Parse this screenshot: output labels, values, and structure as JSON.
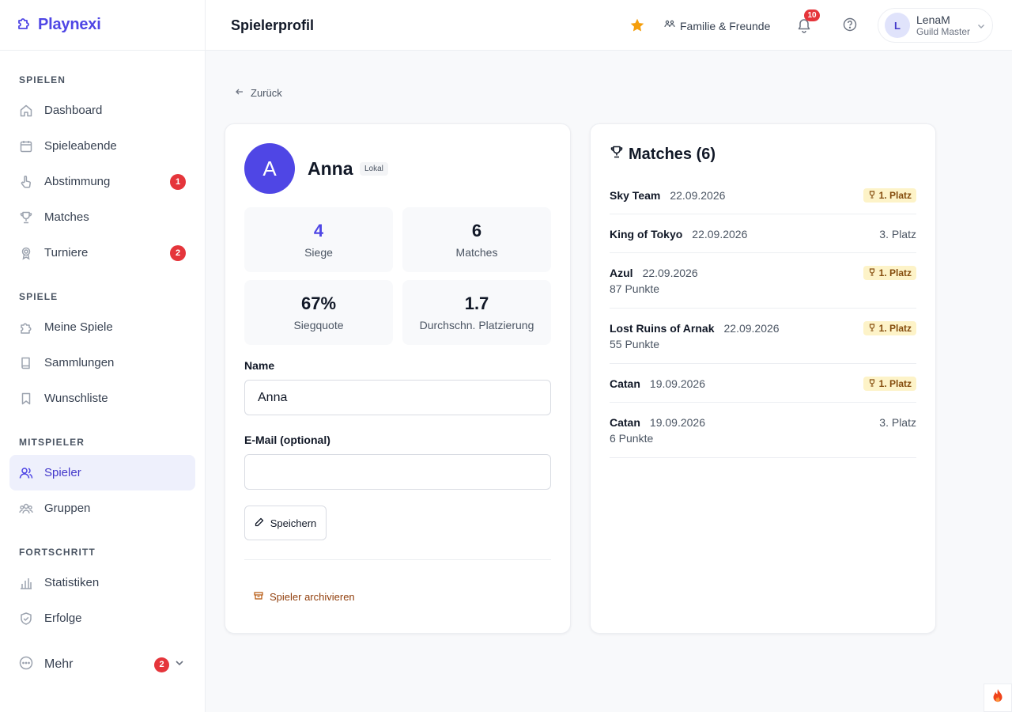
{
  "brand": {
    "name": "Playnexi"
  },
  "header": {
    "title": "Spielerprofil",
    "family_label": "Familie & Freunde",
    "notifications_count": "10",
    "user": {
      "initial": "L",
      "name": "LenaM",
      "role": "Guild Master"
    }
  },
  "sidebar": {
    "sections": [
      {
        "title": "SPIELEN",
        "items": [
          {
            "label": "Dashboard",
            "icon": "home-icon"
          },
          {
            "label": "Spieleabende",
            "icon": "calendar-icon"
          },
          {
            "label": "Abstimmung",
            "icon": "hand-pointer-icon",
            "badge": "1"
          },
          {
            "label": "Matches",
            "icon": "trophy-icon"
          },
          {
            "label": "Turniere",
            "icon": "award-icon",
            "badge": "2"
          }
        ]
      },
      {
        "title": "SPIELE",
        "items": [
          {
            "label": "Meine Spiele",
            "icon": "puzzle-icon"
          },
          {
            "label": "Sammlungen",
            "icon": "book-icon"
          },
          {
            "label": "Wunschliste",
            "icon": "bookmark-icon"
          }
        ]
      },
      {
        "title": "MITSPIELER",
        "items": [
          {
            "label": "Spieler",
            "icon": "users-icon",
            "active": true
          },
          {
            "label": "Gruppen",
            "icon": "group-icon"
          }
        ]
      },
      {
        "title": "FORTSCHRITT",
        "items": [
          {
            "label": "Statistiken",
            "icon": "bar-chart-icon"
          },
          {
            "label": "Erfolge",
            "icon": "shield-check-icon"
          }
        ]
      }
    ],
    "more": {
      "label": "Mehr",
      "badge": "2"
    }
  },
  "main": {
    "back_label": "Zurück",
    "profile": {
      "initial": "A",
      "name": "Anna",
      "badge": "Lokal",
      "stats": {
        "wins": {
          "value": "4",
          "label": "Siege"
        },
        "matches": {
          "value": "6",
          "label": "Matches"
        },
        "win_rate": {
          "value": "67%",
          "label": "Siegquote"
        },
        "avg_place": {
          "value": "1.7",
          "label": "Durchschn. Platzierung"
        }
      },
      "name_label": "Name",
      "name_value": "Anna",
      "email_label": "E-Mail (optional)",
      "email_value": "",
      "save_label": "Speichern",
      "archive_label": "Spieler archivieren"
    },
    "matches": {
      "title": "Matches (6)",
      "rows": [
        {
          "game": "Sky Team",
          "date": "22.09.2026",
          "place": "1. Platz",
          "winner": true,
          "points": ""
        },
        {
          "game": "King of Tokyo",
          "date": "22.09.2026",
          "place": "3. Platz",
          "winner": false,
          "points": ""
        },
        {
          "game": "Azul",
          "date": "22.09.2026",
          "place": "1. Platz",
          "winner": true,
          "points": "87 Punkte"
        },
        {
          "game": "Lost Ruins of Arnak",
          "date": "22.09.2026",
          "place": "1. Platz",
          "winner": true,
          "points": "55 Punkte"
        },
        {
          "game": "Catan",
          "date": "19.09.2026",
          "place": "1. Platz",
          "winner": true,
          "points": ""
        },
        {
          "game": "Catan",
          "date": "19.09.2026",
          "place": "3. Platz",
          "winner": false,
          "points": "6 Punkte"
        }
      ]
    }
  },
  "colors": {
    "accent": "#4f46e5",
    "badge_red": "#e5353b",
    "gold_bg": "#fdf3c8",
    "gold_text": "#854d0e",
    "star": "#f59e0b"
  }
}
